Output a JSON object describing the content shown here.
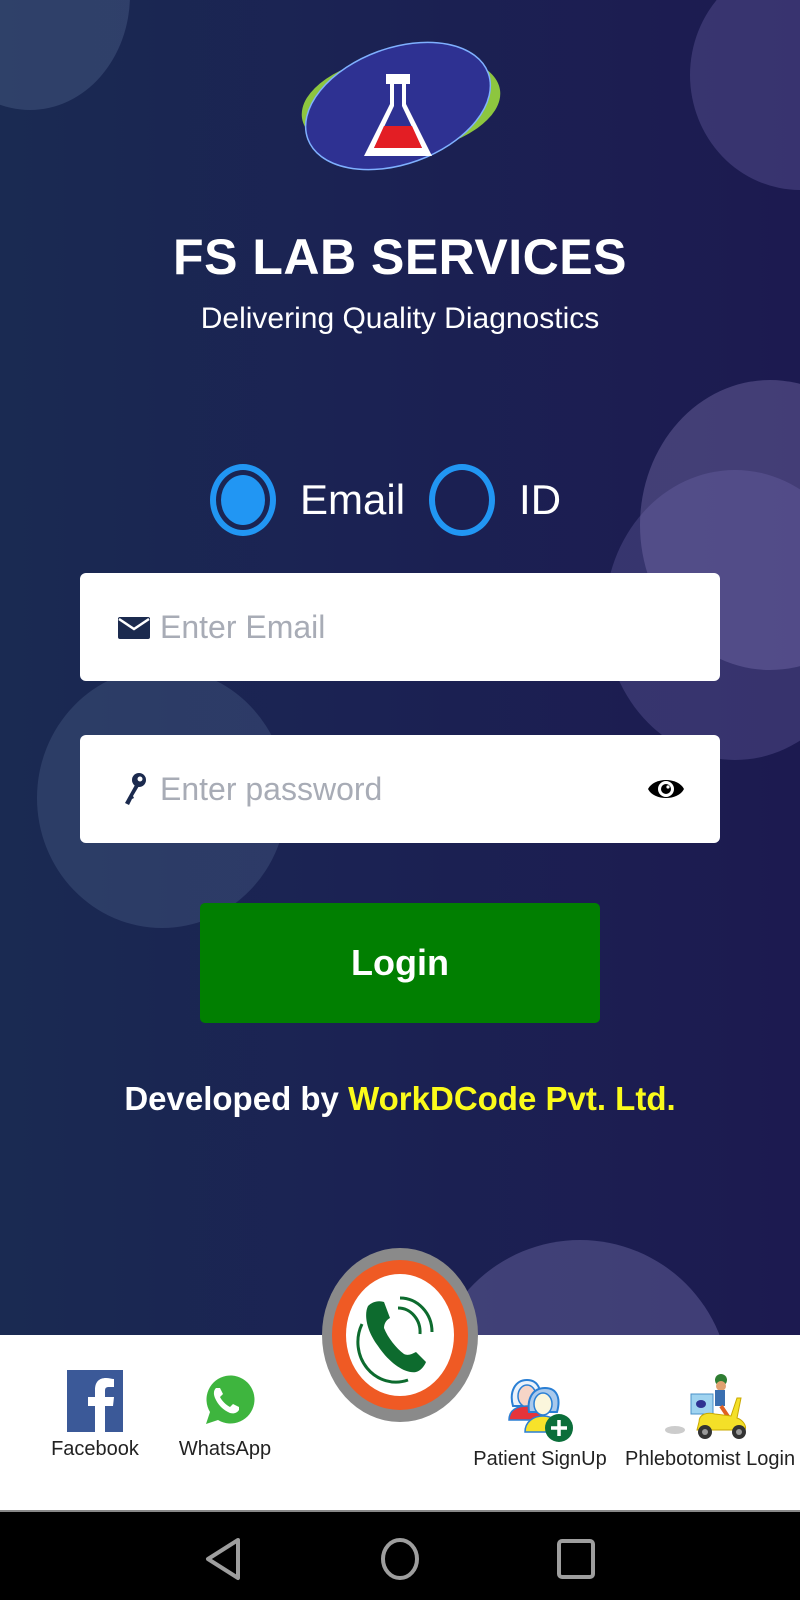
{
  "app": {
    "title": "FS LAB SERVICES",
    "subtitle": "Delivering Quality Diagnostics",
    "logo_icon": "flask-icon"
  },
  "login_type": {
    "options": [
      {
        "label": "Email",
        "selected": true
      },
      {
        "label": "ID",
        "selected": false
      }
    ]
  },
  "form": {
    "email": {
      "value": "",
      "placeholder": "Enter Email",
      "icon": "envelope-icon"
    },
    "password": {
      "value": "",
      "placeholder": "Enter password",
      "icon": "key-icon",
      "toggle_icon": "eye-icon"
    },
    "login_label": "Login"
  },
  "footer_credit": {
    "prefix": "Developed by ",
    "company": "WorkDCode Pvt. Ltd."
  },
  "bottom_bar": {
    "items": [
      {
        "label": "Facebook",
        "icon": "facebook-icon"
      },
      {
        "label": "WhatsApp",
        "icon": "whatsapp-icon"
      },
      {
        "label": "Patient SignUp",
        "icon": "patient-signup-icon"
      },
      {
        "label": "Phlebotomist Login",
        "icon": "scooter-delivery-icon"
      }
    ],
    "call_button_icon": "phone-call-icon"
  },
  "navigation": {
    "buttons": [
      "back",
      "home",
      "recents"
    ]
  },
  "colors": {
    "background": "#1b2253",
    "radio_accent": "#2196f3",
    "login_button": "#017f01",
    "company_highlight": "#fbfb1b",
    "call_ring": "#ef5a24"
  }
}
